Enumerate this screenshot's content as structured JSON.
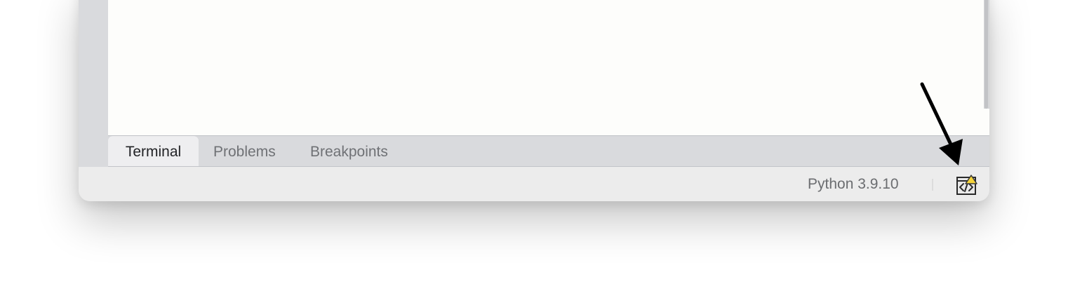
{
  "tabs": [
    {
      "label": "Terminal",
      "active": true
    },
    {
      "label": "Problems",
      "active": false
    },
    {
      "label": "Breakpoints",
      "active": false
    }
  ],
  "statusbar": {
    "interpreter": "Python 3.9.10",
    "preview_icon": "code-preview-warning-icon"
  },
  "annotation": {
    "arrow_icon": "pointer-arrow",
    "color": "#000000"
  },
  "colors": {
    "warning": "#f5d33a",
    "active_tab_bg": "#eeeef0",
    "editor_bg": "#fdfdfb"
  }
}
